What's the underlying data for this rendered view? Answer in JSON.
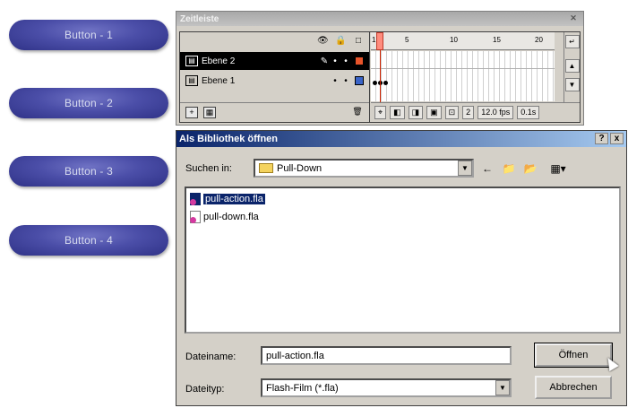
{
  "pills": [
    {
      "label": "Button - 1"
    },
    {
      "label": "Button - 2"
    },
    {
      "label": "Button - 3"
    },
    {
      "label": "Button - 4"
    }
  ],
  "timeline": {
    "title": "Zeitleiste",
    "layers": [
      {
        "name": "Ebene 2",
        "color": "#e8542a",
        "selected": true
      },
      {
        "name": "Ebene 1",
        "color": "#3a64c8",
        "selected": false
      }
    ],
    "ruler_ticks": [
      "1",
      "5",
      "10",
      "15",
      "20"
    ],
    "status": {
      "frame": "2",
      "fps": "12.0 fps",
      "time": "0.1s"
    }
  },
  "dialog": {
    "title": "Als Bibliothek öffnen",
    "help_label": "?",
    "close_label": "x",
    "look_in_label": "Suchen in:",
    "look_in_value": "Pull-Down",
    "files": [
      {
        "name": "pull-action.fla",
        "selected": true
      },
      {
        "name": "pull-down.fla",
        "selected": false
      }
    ],
    "filename_label": "Dateiname:",
    "filename_value": "pull-action.fla",
    "filetype_label": "Dateityp:",
    "filetype_value": "Flash-Film (*.fla)",
    "open_button": "Öffnen",
    "cancel_button": "Abbrechen"
  }
}
